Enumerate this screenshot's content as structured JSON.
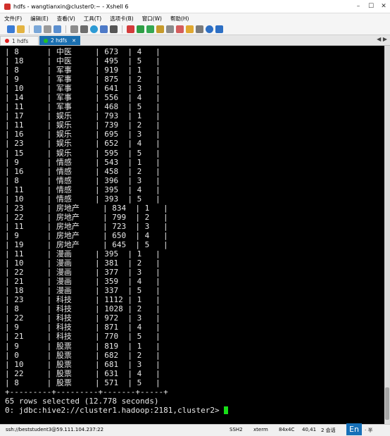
{
  "window": {
    "title": "hdfs - wangtianxin@cluster0:~ - Xshell 6",
    "min": "–",
    "max": "☐",
    "close": "✕"
  },
  "menu": [
    "文件(F)",
    "编辑(E)",
    "查看(V)",
    "工具(T)",
    "选项卡(B)",
    "窗口(W)",
    "帮助(H)"
  ],
  "toolbar_icons": [
    "new-session-icon",
    "open-folder-icon",
    "reconnect-icon",
    "disconnect-icon",
    "properties-icon",
    "copy-icon",
    "find-icon",
    "globe-icon",
    "color-scheme-icon",
    "font-icon",
    "xftp-icon",
    "xmanager-icon",
    "fullscreen-icon",
    "lock-icon",
    "keyboard-icon",
    "compose-icon",
    "script-icon",
    "layout-icon",
    "help-icon",
    "settings-icon"
  ],
  "tabs": [
    {
      "label": "1 hdfs",
      "dot_color": "#e02020"
    },
    {
      "label": "2 hdfs",
      "dot_color": "#22c222"
    }
  ],
  "terminal": {
    "lines": [
      "| 8      | 中医     | 673  | 4   |",
      "| 18     | 中医     | 495  | 5   |",
      "| 8      | 军事     | 919  | 1   |",
      "| 9      | 军事     | 875  | 2   |",
      "| 10     | 军事     | 641  | 3   |",
      "| 14     | 军事     | 556  | 4   |",
      "| 11     | 军事     | 468  | 5   |",
      "| 17     | 娱乐     | 793  | 1   |",
      "| 11     | 娱乐     | 739  | 2   |",
      "| 16     | 娱乐     | 695  | 3   |",
      "| 23     | 娱乐     | 652  | 4   |",
      "| 15     | 娱乐     | 595  | 5   |",
      "| 9      | 情感     | 543  | 1   |",
      "| 16     | 情感     | 458  | 2   |",
      "| 8      | 情感     | 396  | 3   |",
      "| 11     | 情感     | 395  | 4   |",
      "| 10     | 情感     | 393  | 5   |",
      "| 23     | 房地产     | 834  | 1   |",
      "| 22     | 房地产     | 799  | 2   |",
      "| 11     | 房地产     | 723  | 3   |",
      "| 9      | 房地产     | 650  | 4   |",
      "| 19     | 房地产     | 645  | 5   |",
      "| 11     | 漫画     | 395  | 1   |",
      "| 10     | 漫画     | 381  | 2   |",
      "| 22     | 漫画     | 377  | 3   |",
      "| 21     | 漫画     | 359  | 4   |",
      "| 18     | 漫画     | 337  | 5   |",
      "| 23     | 科技     | 1112 | 1   |",
      "| 8      | 科技     | 1028 | 2   |",
      "| 22     | 科技     | 972  | 3   |",
      "| 9      | 科技     | 871  | 4   |",
      "| 21     | 科技     | 770  | 5   |",
      "| 9      | 股票     | 819  | 1   |",
      "| 0      | 股票     | 682  | 2   |",
      "| 10     | 股票     | 681  | 3   |",
      "| 22     | 股票     | 631  | 4   |",
      "| 8      | 股票     | 571  | 5   |",
      "+---------+---------+-------+-----+",
      "65 rows selected (12.778 seconds)"
    ],
    "prompt": "0: jdbc:hive2://cluster1.hadoop:2181,cluster2> "
  },
  "status": {
    "connection": "ssh://beststudent3@59.111.104.237:22",
    "protocol": "SSH2",
    "terminal_type": "xterm",
    "size": "84x4C",
    "cursor_pos": "40,41",
    "sessions": "2 会话",
    "ime_label": "En",
    "ime_extra": "· 半"
  }
}
